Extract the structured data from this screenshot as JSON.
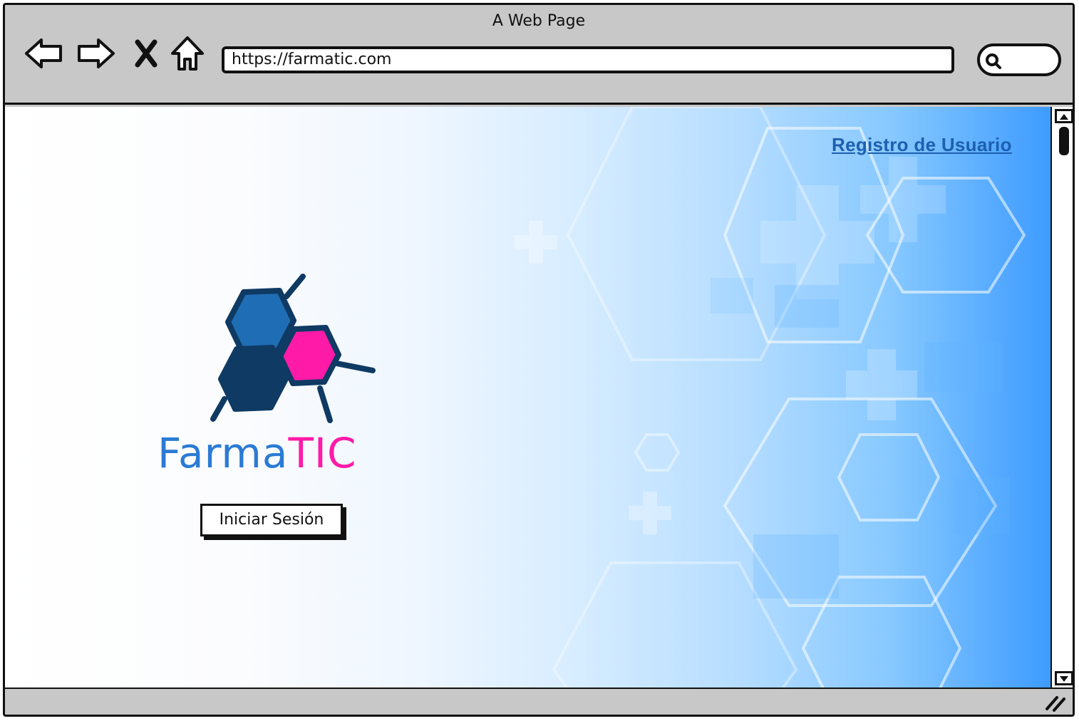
{
  "browser": {
    "title": "A Web Page",
    "url": "https://farmatic.com",
    "nav_icons": [
      "back-icon",
      "forward-icon",
      "close-icon",
      "home-icon"
    ],
    "search_icon": "search-icon"
  },
  "page": {
    "register_link": "Registro de Usuario",
    "brand": {
      "part1": "Farma",
      "part2": "TIC"
    },
    "login_button": "Iniciar Sesión"
  },
  "colors": {
    "link": "#1d5fb0",
    "brand_blue": "#2b7bd4",
    "brand_pink": "#ff1aa8",
    "hex_dark": "#0e3a63",
    "hex_mid": "#1f6db5",
    "chrome": "#c8c8c8"
  }
}
